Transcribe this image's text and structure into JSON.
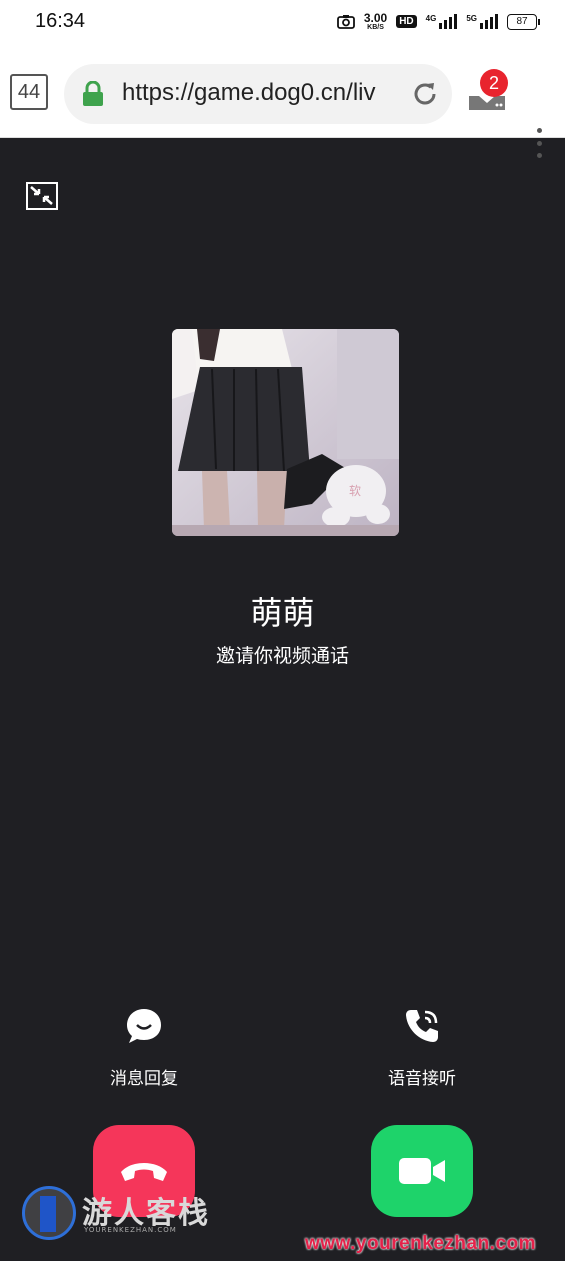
{
  "status_bar": {
    "time": "16:34",
    "net_speed_value": "3.00",
    "net_speed_unit": "KB/S",
    "hd_label": "HD",
    "signal_1_label": "4G",
    "signal_2_label": "5G",
    "battery": "87"
  },
  "browser": {
    "tab_count": "44",
    "url": "https://game.dog0.cn/liv",
    "download_badge": "2"
  },
  "call": {
    "caller_name": "萌萌",
    "caller_subtitle": "邀请你视频通话",
    "message_reply_label": "消息回复",
    "voice_answer_label": "语音接听"
  },
  "watermark": {
    "brand": "游人客栈",
    "brand_sub": "YOURENKEZHAN.COM",
    "url": "www.yourenkezhan.com"
  },
  "colors": {
    "background": "#1f1f23",
    "decline": "#f5365a",
    "accept": "#1ed36a",
    "badge": "#e8242e",
    "lock": "#3fa34d"
  }
}
